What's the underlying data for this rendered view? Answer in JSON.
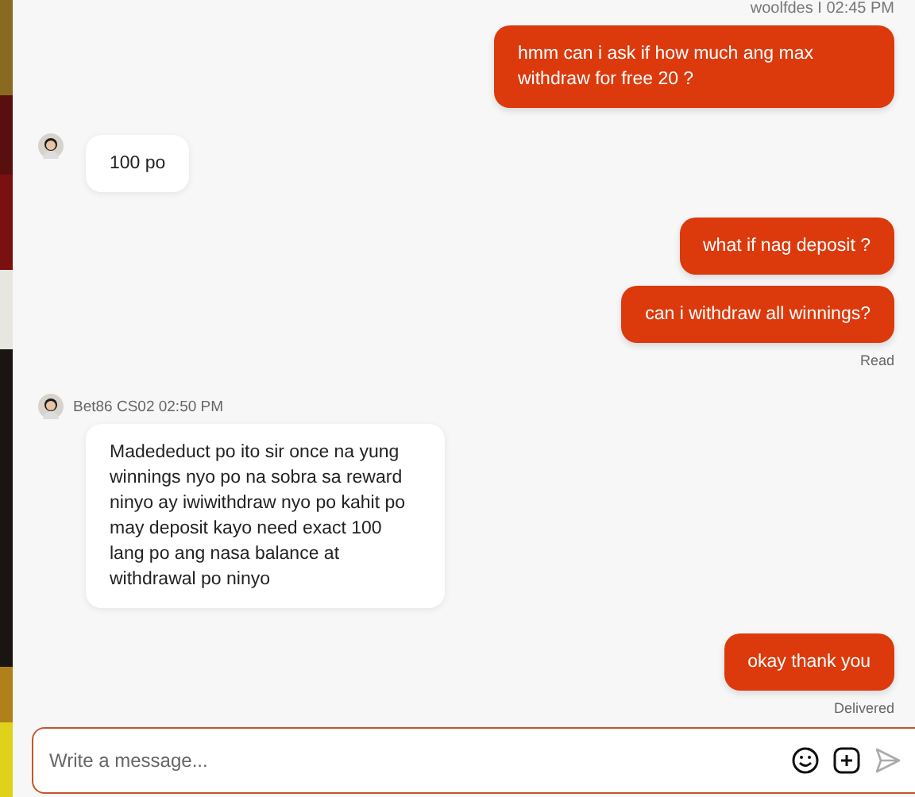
{
  "header_meta": "woolfdes I 02:45 PM",
  "groups": [
    {
      "kind": "outgoing",
      "messages": [
        "hmm can i ask if how much ang max withdraw for free 20 ?"
      ]
    },
    {
      "kind": "incoming",
      "messages": [
        "100 po"
      ]
    },
    {
      "kind": "outgoing",
      "messages": [
        "what if nag deposit ?",
        "can i withdraw all winnings?"
      ],
      "status": "Read"
    },
    {
      "kind": "incoming",
      "sender": "Bet86 CS02 02:50 PM",
      "messages": [
        "Madededuct po ito sir once na yung winnings nyo po na sobra sa reward ninyo ay iwiwithdraw nyo po kahit po may deposit kayo need exact 100 lang po ang nasa balance at withdrawal po ninyo"
      ]
    },
    {
      "kind": "outgoing",
      "messages": [
        "okay thank you"
      ],
      "status": "Delivered"
    }
  ],
  "composer": {
    "placeholder": "Write a message..."
  }
}
